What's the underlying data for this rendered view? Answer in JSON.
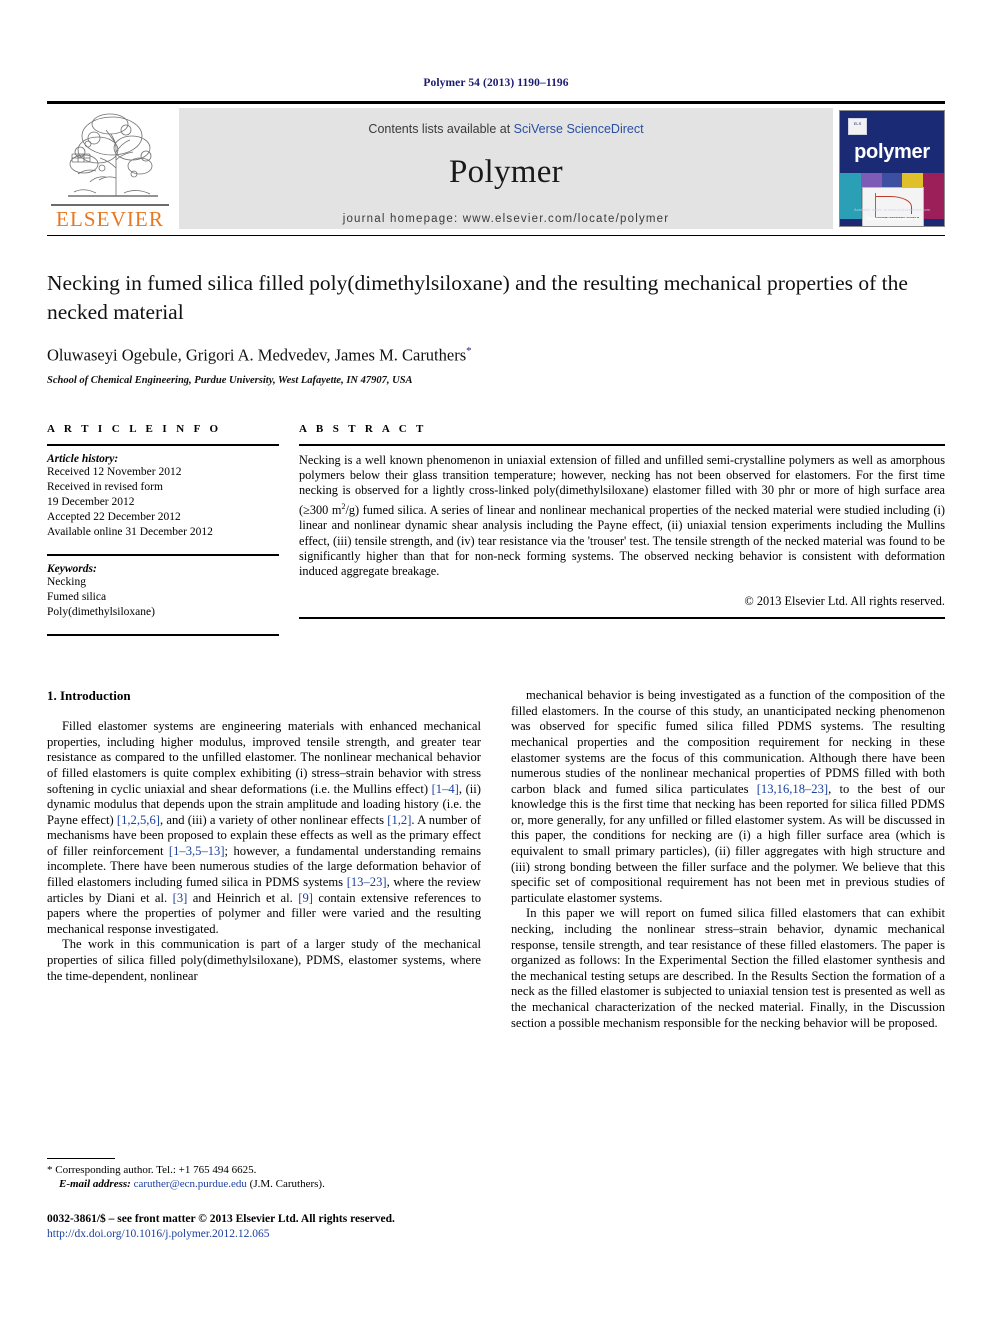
{
  "running_head": "Polymer 54 (2013) 1190–1196",
  "masthead": {
    "elsevier_wordmark": "ELSEVIER",
    "contents_prefix": "Contents lists available at ",
    "contents_link": "SciVerse ScienceDirect",
    "journal_title": "Polymer",
    "homepage": "journal homepage: www.elsevier.com/locate/polymer",
    "cover": {
      "wordmark": "polymer",
      "logo_text": "ELS",
      "caption_small": "Available online at www.sciencedirect.com",
      "caption_brand": "SciVerse ScienceDirect"
    },
    "colors": {
      "elsevier_orange": "#E87722",
      "banner_grey": "#E3E3E3",
      "link_blue": "#2B4F9E",
      "cover_navy": "#1B2A74"
    }
  },
  "article": {
    "title": "Necking in fumed silica filled poly(dimethylsiloxane) and the resulting mechanical properties of the necked material",
    "authors": "Oluwaseyi Ogebule, Grigori A. Medvedev, James M. Caruthers",
    "corresponding_marker": "*",
    "affiliation": "School of Chemical Engineering, Purdue University, West Lafayette, IN 47907, USA"
  },
  "article_info": {
    "label": "A R T I C L E   I N F O",
    "history_title": "Article history:",
    "history": [
      "Received 12 November 2012",
      "Received in revised form",
      "19 December 2012",
      "Accepted 22 December 2012",
      "Available online 31 December 2012"
    ],
    "keywords_title": "Keywords:",
    "keywords": [
      "Necking",
      "Fumed silica",
      "Poly(dimethylsiloxane)"
    ]
  },
  "abstract": {
    "label": "A B S T R A C T",
    "part1": "Necking is a well known phenomenon in uniaxial extension of filled and unfilled semi-crystalline polymers as well as amorphous polymers below their glass transition temperature; however, necking has not been observed for elastomers. For the first time necking is observed for a lightly cross-linked poly(dimethylsiloxane) elastomer filled with 30 phr or more of high surface area (≥300 m",
    "superscript": "2",
    "part2": "/g) fumed silica. A series of linear and nonlinear mechanical properties of the necked material were studied including (i) linear and nonlinear dynamic shear analysis including the Payne effect, (ii) uniaxial tension experiments including the Mullins effect, (iii) tensile strength, and (iv) tear resistance via the 'trouser' test. The tensile strength of the necked material was found to be significantly higher than that for non-neck forming systems. The observed necking behavior is consistent with deformation induced aggregate breakage.",
    "copyright": "© 2013 Elsevier Ltd. All rights reserved."
  },
  "introduction": {
    "heading": "1. Introduction",
    "left_paragraphs": [
      {
        "segments": [
          {
            "t": "Filled elastomer systems are engineering materials with enhanced mechanical properties, including higher modulus, improved tensile strength, and greater tear resistance as compared to the unfilled elastomer. The nonlinear mechanical behavior of filled elastomers is quite complex exhibiting (i) stress–strain behavior with stress softening in cyclic uniaxial and shear deformations (i.e. the Mullins effect) "
          },
          {
            "t": "[1–4]",
            "cite": true
          },
          {
            "t": ", (ii) dynamic modulus that depends upon the strain amplitude and loading history (i.e. the Payne effect) "
          },
          {
            "t": "[1,2,5,6]",
            "cite": true
          },
          {
            "t": ", and (iii) a variety of other nonlinear effects "
          },
          {
            "t": "[1,2]",
            "cite": true
          },
          {
            "t": ". A number of mechanisms have been proposed to explain these effects as well as the primary effect of filler reinforcement "
          },
          {
            "t": "[1–3,5–13]",
            "cite": true
          },
          {
            "t": "; however, a fundamental understanding remains incomplete. There have been numerous studies of the large deformation behavior of filled elastomers including fumed silica in PDMS systems "
          },
          {
            "t": "[13–23]",
            "cite": true
          },
          {
            "t": ", where the review articles by Diani et al. "
          },
          {
            "t": "[3]",
            "cite": true
          },
          {
            "t": " and Heinrich et al. "
          },
          {
            "t": "[9]",
            "cite": true
          },
          {
            "t": " contain extensive references to papers where the properties of polymer and filler were varied and the resulting mechanical response investigated."
          }
        ]
      },
      {
        "segments": [
          {
            "t": "The work in this communication is part of a larger study of the mechanical properties of silica filled poly(dimethylsiloxane), PDMS, elastomer systems, where the time-dependent, nonlinear"
          }
        ]
      }
    ],
    "right_paragraphs": [
      {
        "segments": [
          {
            "t": "mechanical behavior is being investigated as a function of the composition of the filled elastomers. In the course of this study, an unanticipated necking phenomenon was observed for specific fumed silica filled PDMS systems. The resulting mechanical properties and the composition requirement for necking in these elastomer systems are the focus of this communication. Although there have been numerous studies of the nonlinear mechanical properties of PDMS filled with both carbon black and fumed silica particulates "
          },
          {
            "t": "[13,16,18–23]",
            "cite": true
          },
          {
            "t": ", to the best of our knowledge this is the first time that necking has been reported for silica filled PDMS or, more generally, for any unfilled or filled elastomer system. As will be discussed in this paper, the conditions for necking are (i) a high filler surface area (which is equivalent to small primary particles), (ii) filler aggregates with high structure and (iii) strong bonding between the filler surface and the polymer. We believe that this specific set of compositional requirement has not been met in previous studies of particulate elastomer systems."
          }
        ]
      },
      {
        "segments": [
          {
            "t": "In this paper we will report on fumed silica filled elastomers that can exhibit necking, including the nonlinear stress–strain behavior, dynamic mechanical response, tensile strength, and tear resistance of these filled elastomers. The paper is organized as follows: In the Experimental Section the filled elastomer synthesis and the mechanical testing setups are described. In the Results Section the formation of a neck as the filled elastomer is subjected to uniaxial tension test is presented as well as the mechanical characterization of the necked material. Finally, in the Discussion section a possible mechanism responsible for the necking behavior will be proposed."
          }
        ]
      }
    ]
  },
  "footnote": {
    "marker": "*",
    "corresponding": "Corresponding author. Tel.: +1 765 494 6625.",
    "email_label": "E-mail address:",
    "email": "caruther@ecn.purdue.edu",
    "email_owner": "(J.M. Caruthers)."
  },
  "page_footer": {
    "issn_line": "0032-3861/$ – see front matter © 2013 Elsevier Ltd. All rights reserved.",
    "doi": "http://dx.doi.org/10.1016/j.polymer.2012.12.065"
  }
}
